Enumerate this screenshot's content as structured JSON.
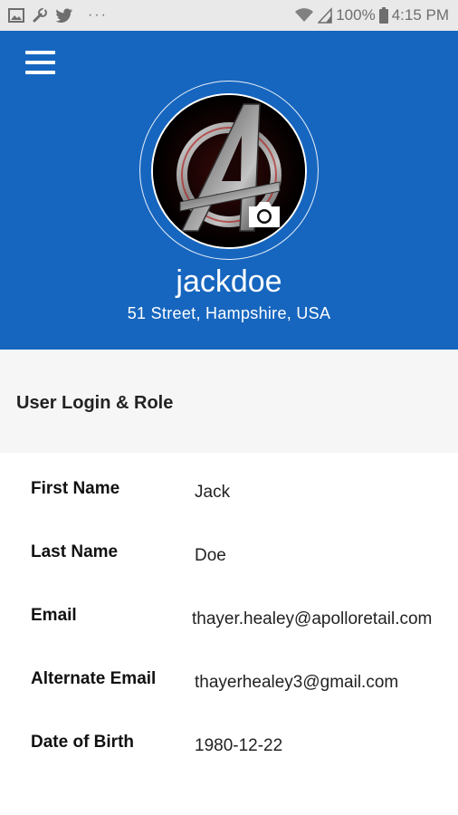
{
  "status_bar": {
    "left_icons": [
      "image-icon",
      "wrench-icon",
      "twitter-icon"
    ],
    "more": "···",
    "battery": "100%",
    "time": "4:15 PM"
  },
  "profile": {
    "username": "jackdoe",
    "address": "51 Street, Hampshire, USA"
  },
  "section": {
    "title": "User Login & Role"
  },
  "fields": [
    {
      "label": "First Name",
      "value": "Jack"
    },
    {
      "label": "Last Name",
      "value": "Doe"
    },
    {
      "label": "Email",
      "value": "thayer.healey@apolloretail.com"
    },
    {
      "label": "Alternate Email",
      "value": "thayerhealey3@gmail.com"
    },
    {
      "label": "Date of Birth",
      "value": "1980-12-22"
    }
  ],
  "colors": {
    "header": "#1666bf",
    "section_bg": "#f6f6f6",
    "statusbar_bg": "#e9e9e9"
  }
}
